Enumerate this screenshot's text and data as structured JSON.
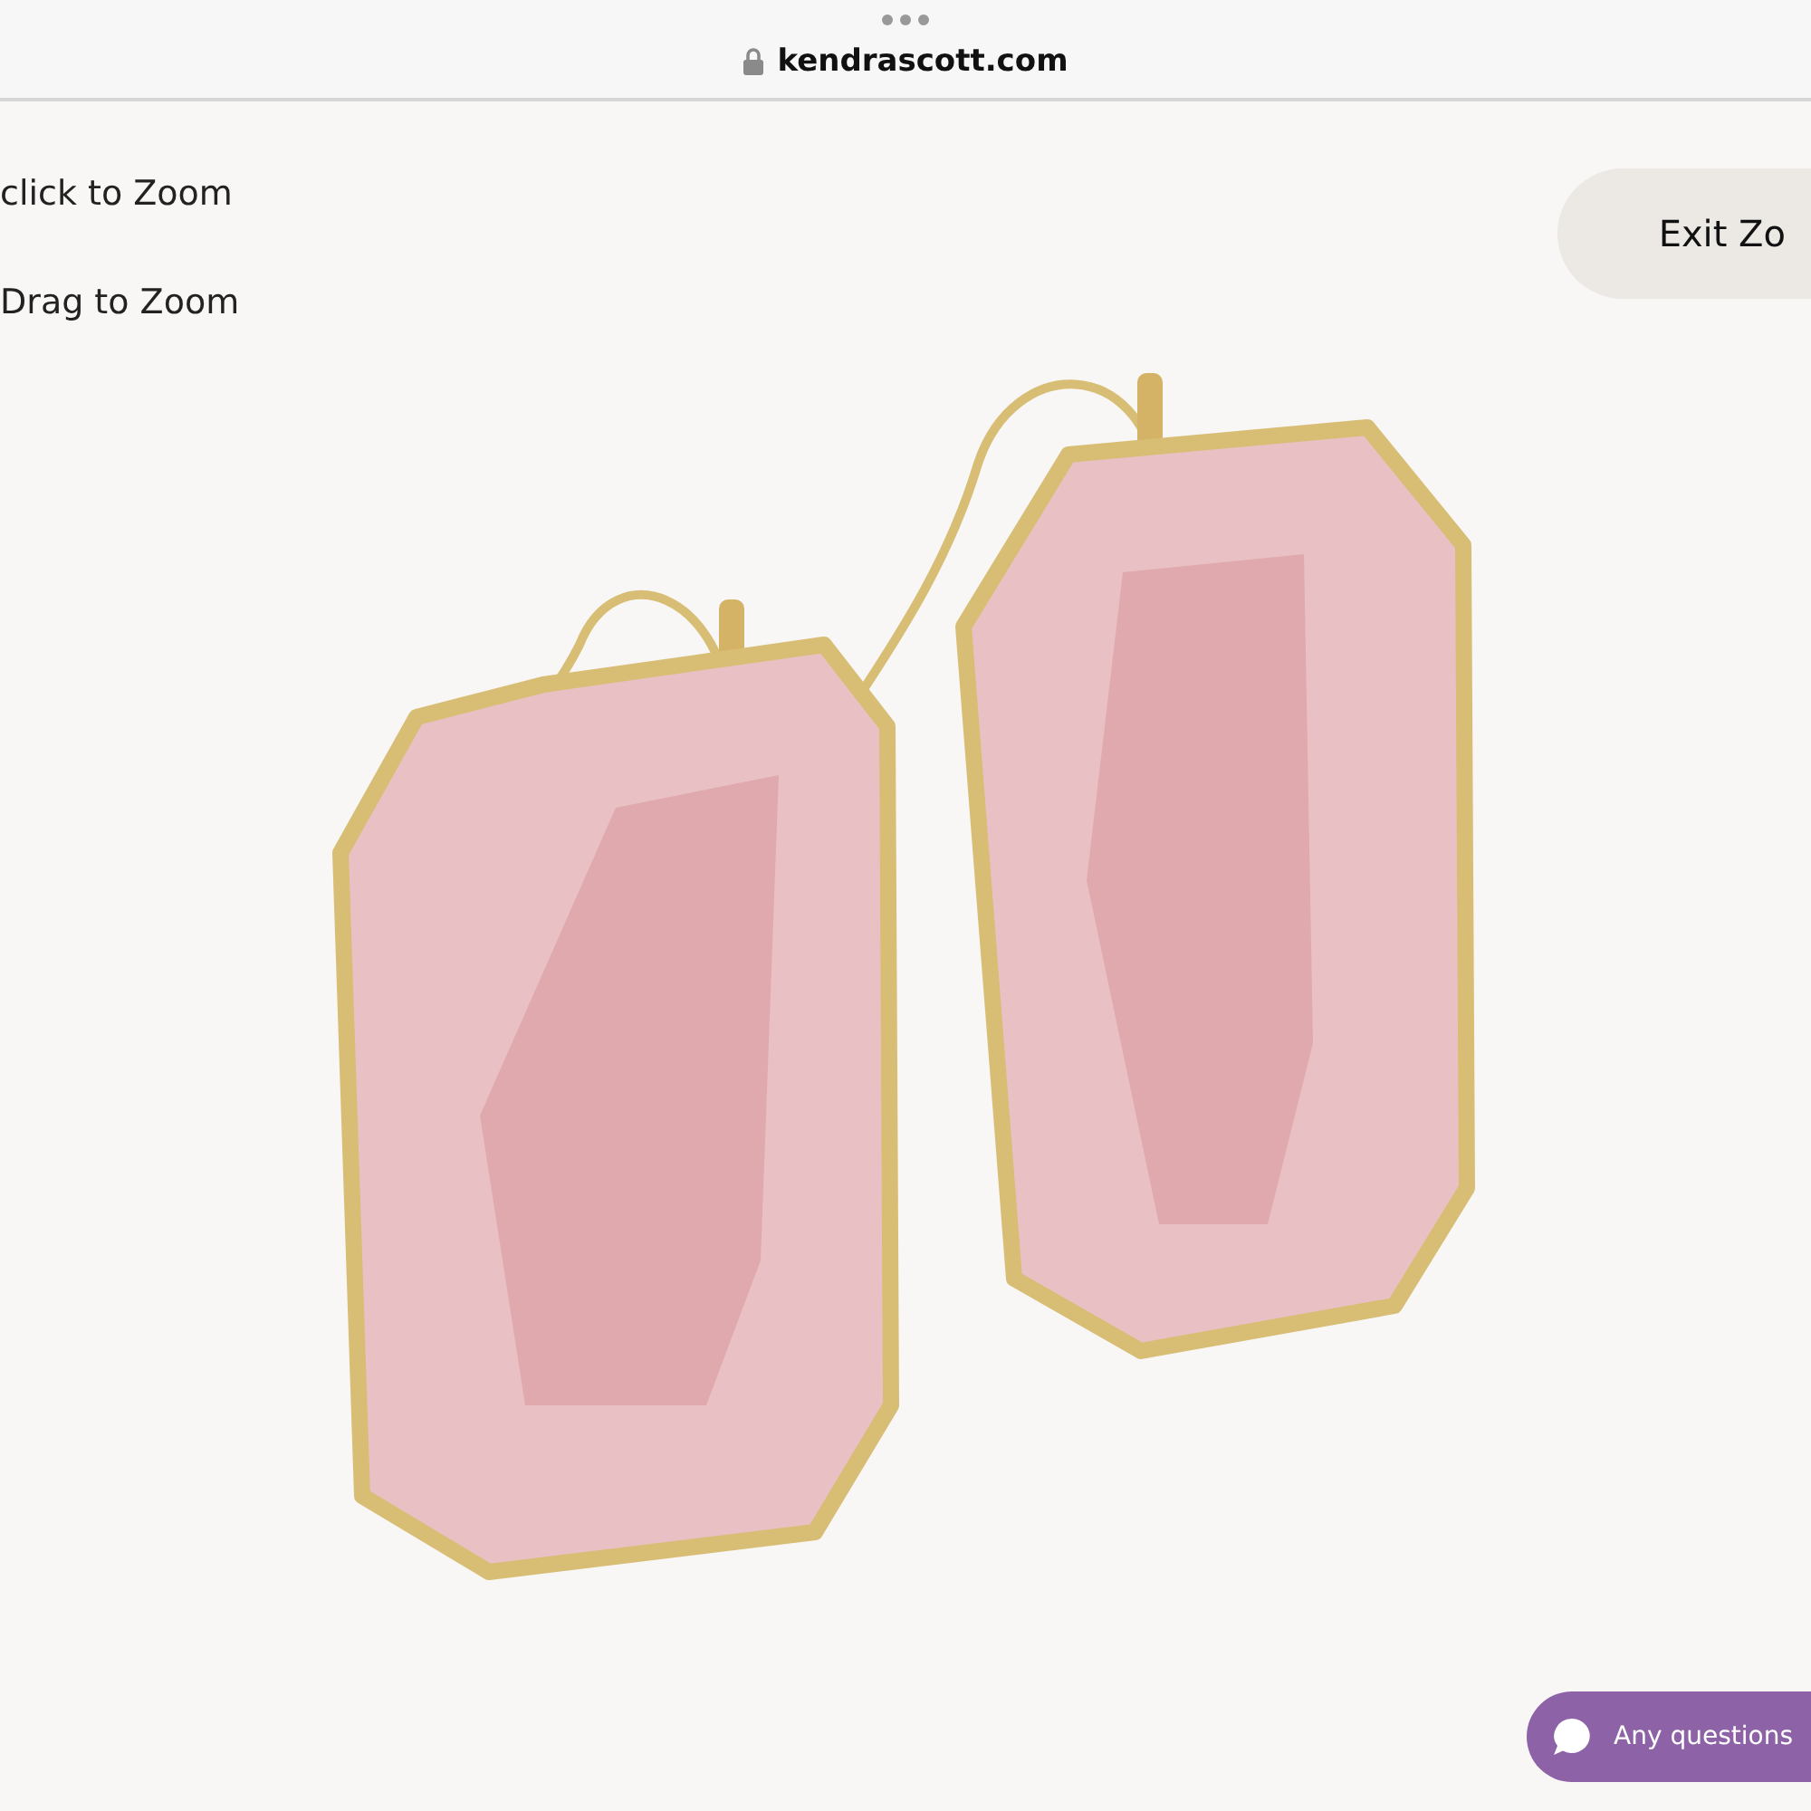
{
  "browser_bar": {
    "url": "kendrascott.com"
  },
  "zoom_hints": [
    "click to Zoom",
    "Drag to Zoom"
  ],
  "exit_button": {
    "label": "Exit Zo"
  },
  "chat_button": {
    "label": "Any questions"
  }
}
